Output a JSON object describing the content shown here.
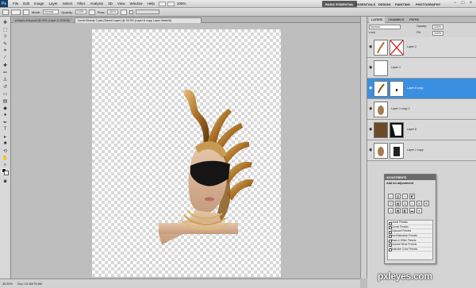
{
  "menubar": {
    "logo": "Ps",
    "items": [
      "File",
      "Edit",
      "Image",
      "Layer",
      "Select",
      "Filter",
      "Analysis",
      "3D",
      "View",
      "Window",
      "Help"
    ],
    "zoom": "100%",
    "workspaces": [
      "BASIC ESSENTIAL",
      "ESSENTIALS",
      "DESIGN",
      "PAINTING",
      "PHOTOGRAPHY"
    ],
    "active_workspace": "BASIC ESSENTIAL"
  },
  "options": {
    "mode_label": "Mode:",
    "mode_value": "Normal",
    "opacity_label": "Opacity:",
    "opacity_value": "100%",
    "flow_label": "Flow:",
    "flow_value": "100%"
  },
  "tabs": [
    "pxleyes-entry.psd @ 25% (Layer 3, RGB/8)",
    "Iconic Beauty 2.psd (Saved Layer) @ 45.3% (Layer 8 copy, Layer Mask/8)"
  ],
  "status": {
    "zoom": "45.33%",
    "doc": "Doc: 15.4M/76.5M"
  },
  "layers_panel": {
    "tabs": [
      "LAYERS",
      "CHANNELS",
      "PATHS"
    ],
    "blend": "Normal",
    "opacity_label": "Opacity:",
    "opacity": "100%",
    "lock_label": "Lock:",
    "fill_label": "Fill:",
    "fill": "100%",
    "layers": [
      {
        "name": "Layer 2",
        "selected": false
      },
      {
        "name": "Layer 1",
        "selected": false
      },
      {
        "name": "Layer 8 copy",
        "selected": true
      },
      {
        "name": "Layer 1 copy 2",
        "selected": false
      },
      {
        "name": "Layer 8",
        "selected": false
      },
      {
        "name": "Layer 1 copy",
        "selected": false
      }
    ]
  },
  "adjustments": {
    "header": "ADJUSTMENTS",
    "title": "Add an adjustment",
    "presets": [
      "Levels Presets",
      "Curves Presets",
      "Exposure Presets",
      "Hue/Saturation Presets",
      "Black & White Presets",
      "Channel Mixer Presets",
      "Selective Color Presets"
    ]
  },
  "watermark": "pxleyes.com"
}
